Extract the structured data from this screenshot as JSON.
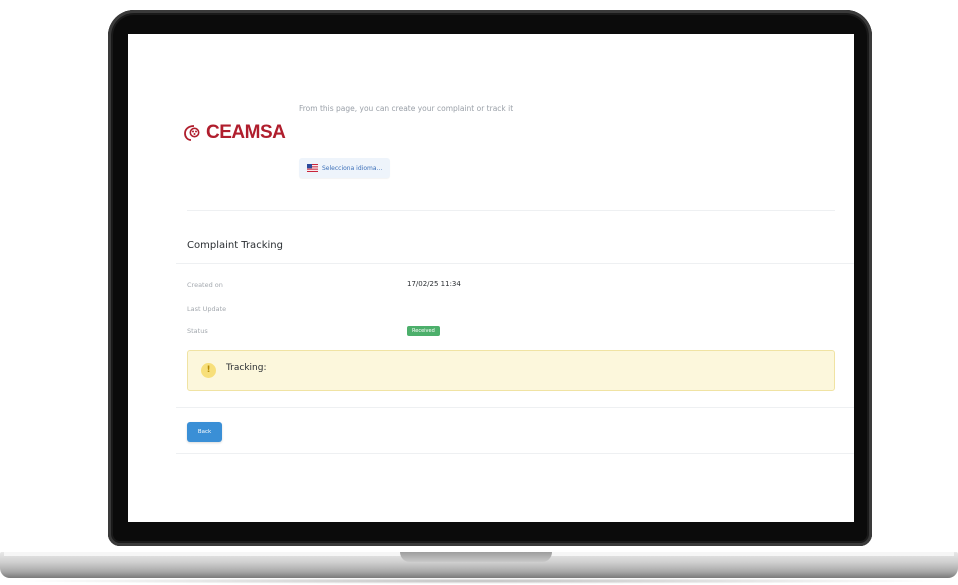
{
  "brand": {
    "name": "CEAMSA",
    "color": "#b01e2d"
  },
  "header": {
    "intro_text": "From this page, you can create your complaint or track it",
    "language_button": {
      "label": "Selecciona idioma...",
      "icon": "us-flag-icon"
    }
  },
  "tracking": {
    "title": "Complaint Tracking",
    "fields": [
      {
        "label": "Created on",
        "value": "17/02/25 11:34"
      },
      {
        "label": "Last Update",
        "value": ""
      },
      {
        "label": "Status",
        "value": "Received"
      }
    ],
    "status_color": "#4caf6b",
    "notice": {
      "icon": "warning-icon",
      "label": "Tracking:"
    }
  },
  "actions": {
    "back_label": "Back",
    "back_color": "#3a8fd6"
  }
}
